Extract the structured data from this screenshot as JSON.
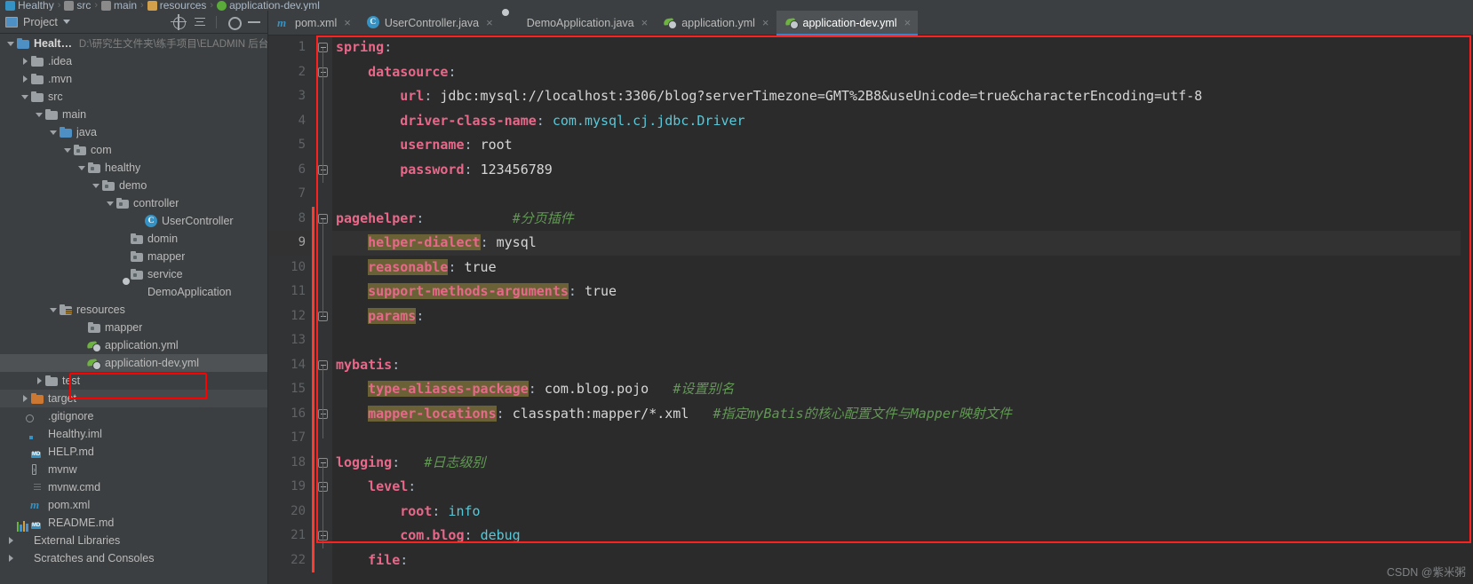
{
  "breadcrumb": [
    {
      "label": "Healthy",
      "icon": "module-icon"
    },
    {
      "label": "src",
      "icon": "folder-icon"
    },
    {
      "label": "main",
      "icon": "folder-icon"
    },
    {
      "label": "resources",
      "icon": "resources-folder-icon"
    },
    {
      "label": "application-dev.yml",
      "icon": "yaml-icon"
    }
  ],
  "panel": {
    "title": "Project",
    "buttons": [
      {
        "name": "locate-in-tree",
        "label": "Select Opened File"
      },
      {
        "name": "collapse-all",
        "label": "Collapse All"
      },
      {
        "name": "settings",
        "label": "Settings"
      },
      {
        "name": "hide",
        "label": "Hide"
      }
    ]
  },
  "tree": [
    {
      "label": "Healthy",
      "path": "D:\\研究生文件夹\\练手项目\\ELADMIN 后台",
      "indent": 0,
      "arrow": "open",
      "icon": "module-icon",
      "bold": true
    },
    {
      "label": ".idea",
      "indent": 1,
      "arrow": "closed",
      "icon": "folder-icon"
    },
    {
      "label": ".mvn",
      "indent": 1,
      "arrow": "closed",
      "icon": "folder-icon"
    },
    {
      "label": "src",
      "indent": 1,
      "arrow": "open",
      "icon": "folder-icon"
    },
    {
      "label": "main",
      "indent": 2,
      "arrow": "open",
      "icon": "folder-icon"
    },
    {
      "label": "java",
      "indent": 3,
      "arrow": "open",
      "icon": "source-folder-icon"
    },
    {
      "label": "com",
      "indent": 4,
      "arrow": "open",
      "icon": "package-icon"
    },
    {
      "label": "healthy",
      "indent": 5,
      "arrow": "open",
      "icon": "package-icon"
    },
    {
      "label": "demo",
      "indent": 6,
      "arrow": "open",
      "icon": "package-icon"
    },
    {
      "label": "controller",
      "indent": 7,
      "arrow": "open",
      "icon": "package-icon"
    },
    {
      "label": "UserController",
      "indent": 9,
      "arrow": "none",
      "icon": "java-class-icon"
    },
    {
      "label": "domin",
      "indent": 8,
      "arrow": "none",
      "icon": "package-icon"
    },
    {
      "label": "mapper",
      "indent": 8,
      "arrow": "none",
      "icon": "package-icon"
    },
    {
      "label": "service",
      "indent": 8,
      "arrow": "none",
      "icon": "package-icon"
    },
    {
      "label": "DemoApplication",
      "indent": 8,
      "arrow": "none",
      "icon": "spring-boot-icon"
    },
    {
      "label": "resources",
      "indent": 3,
      "arrow": "open",
      "icon": "resources-folder-icon"
    },
    {
      "label": "mapper",
      "indent": 5,
      "arrow": "none",
      "icon": "package-icon"
    },
    {
      "label": "application.yml",
      "indent": 5,
      "arrow": "none",
      "icon": "yaml-icon"
    },
    {
      "label": "application-dev.yml",
      "indent": 5,
      "arrow": "none",
      "icon": "yaml-icon",
      "selected": true,
      "annotated": true
    },
    {
      "label": "test",
      "indent": 2,
      "arrow": "closed",
      "icon": "folder-icon"
    },
    {
      "label": "target",
      "indent": 1,
      "arrow": "closed",
      "icon": "target-folder-icon",
      "highlight": true
    },
    {
      "label": ".gitignore",
      "indent": 1,
      "arrow": "none",
      "icon": "gitignore-icon"
    },
    {
      "label": "Healthy.iml",
      "indent": 1,
      "arrow": "none",
      "icon": "iml-icon"
    },
    {
      "label": "HELP.md",
      "indent": 1,
      "arrow": "none",
      "icon": "markdown-icon"
    },
    {
      "label": "mvnw",
      "indent": 1,
      "arrow": "none",
      "icon": "shell-script-icon"
    },
    {
      "label": "mvnw.cmd",
      "indent": 1,
      "arrow": "none",
      "icon": "cmd-script-icon"
    },
    {
      "label": "pom.xml",
      "indent": 1,
      "arrow": "none",
      "icon": "maven-icon"
    },
    {
      "label": "README.md",
      "indent": 1,
      "arrow": "none",
      "icon": "markdown-icon"
    },
    {
      "label": "External Libraries",
      "indent": 0,
      "arrow": "closed",
      "icon": "libraries-icon"
    },
    {
      "label": "Scratches and Consoles",
      "indent": 0,
      "arrow": "closed",
      "icon": "scratches-icon"
    }
  ],
  "tabs": [
    {
      "label": "pom.xml",
      "icon": "maven-icon",
      "active": false
    },
    {
      "label": "UserController.java",
      "icon": "java-class-icon",
      "active": false
    },
    {
      "label": "DemoApplication.java",
      "icon": "spring-boot-icon",
      "active": false
    },
    {
      "label": "application.yml",
      "icon": "yaml-icon",
      "active": false
    },
    {
      "label": "application-dev.yml",
      "icon": "yaml-icon",
      "active": true
    }
  ],
  "editor": {
    "close_glyph": "×",
    "lines": [
      {
        "n": 1,
        "indent": 0,
        "key": "spring",
        "value": "",
        "comment": "",
        "fold": "start"
      },
      {
        "n": 2,
        "indent": 1,
        "key": "datasource",
        "value": "",
        "comment": "",
        "fold": "start"
      },
      {
        "n": 3,
        "indent": 2,
        "key": "url",
        "value": "jdbc:mysql://localhost:3306/blog?serverTimezone=GMT%2B8&useUnicode=true&characterEncoding=utf-8",
        "comment": ""
      },
      {
        "n": 4,
        "indent": 2,
        "key": "driver-class-name",
        "value": "com.mysql.cj.jdbc.Driver",
        "valueClass": "vc",
        "comment": ""
      },
      {
        "n": 5,
        "indent": 2,
        "key": "username",
        "value": "root",
        "comment": ""
      },
      {
        "n": 6,
        "indent": 2,
        "key": "password",
        "value": "123456789",
        "comment": "",
        "fold": "end"
      },
      {
        "n": 7,
        "indent": 0,
        "key": "",
        "value": "",
        "comment": ""
      },
      {
        "n": 8,
        "indent": 0,
        "key": "pagehelper",
        "value": "",
        "comment": "#分页插件",
        "fold": "start"
      },
      {
        "n": 9,
        "indent": 1,
        "key": "helper-dialect",
        "value": "mysql",
        "comment": "",
        "warn": true,
        "current": true
      },
      {
        "n": 10,
        "indent": 1,
        "key": "reasonable",
        "value": "true",
        "comment": "",
        "warn": true
      },
      {
        "n": 11,
        "indent": 1,
        "key": "support-methods-arguments",
        "value": "true",
        "comment": "",
        "warn": true
      },
      {
        "n": 12,
        "indent": 1,
        "key": "params",
        "value": "",
        "comment": "",
        "warn": true,
        "fold": "end"
      },
      {
        "n": 13,
        "indent": 0,
        "key": "",
        "value": "",
        "comment": ""
      },
      {
        "n": 14,
        "indent": 0,
        "key": "mybatis",
        "value": "",
        "comment": "",
        "fold": "start"
      },
      {
        "n": 15,
        "indent": 1,
        "key": "type-aliases-package",
        "value": "com.blog.pojo",
        "comment": "#设置别名",
        "warn": true
      },
      {
        "n": 16,
        "indent": 1,
        "key": "mapper-locations",
        "value": "classpath:mapper/*.xml",
        "comment": "#指定myBatis的核心配置文件与Mapper映射文件",
        "warn": true,
        "fold": "end"
      },
      {
        "n": 17,
        "indent": 0,
        "key": "",
        "value": "",
        "comment": ""
      },
      {
        "n": 18,
        "indent": 0,
        "key": "logging",
        "value": "",
        "comment": "#日志级别",
        "fold": "start"
      },
      {
        "n": 19,
        "indent": 1,
        "key": "level",
        "value": "",
        "comment": "",
        "fold": "start"
      },
      {
        "n": 20,
        "indent": 2,
        "key": "root",
        "value": "info",
        "valueClass": "vc",
        "comment": ""
      },
      {
        "n": 21,
        "indent": 2,
        "key": "com.blog",
        "value": "debug",
        "valueClass": "vc",
        "comment": "",
        "fold": "end"
      },
      {
        "n": 22,
        "indent": 1,
        "key": "file",
        "value": "",
        "comment": ""
      }
    ]
  },
  "watermark": "CSDN @紫米粥",
  "colors": {
    "accent": "#3d86c6",
    "annotation": "#ff0000",
    "key": "#e8688a",
    "value_cyan": "#59c8d8",
    "comment": "#629755",
    "warn_highlight": "#6b6136",
    "editor_bg": "#2b2b2b",
    "panel_bg": "#3c3f41"
  }
}
